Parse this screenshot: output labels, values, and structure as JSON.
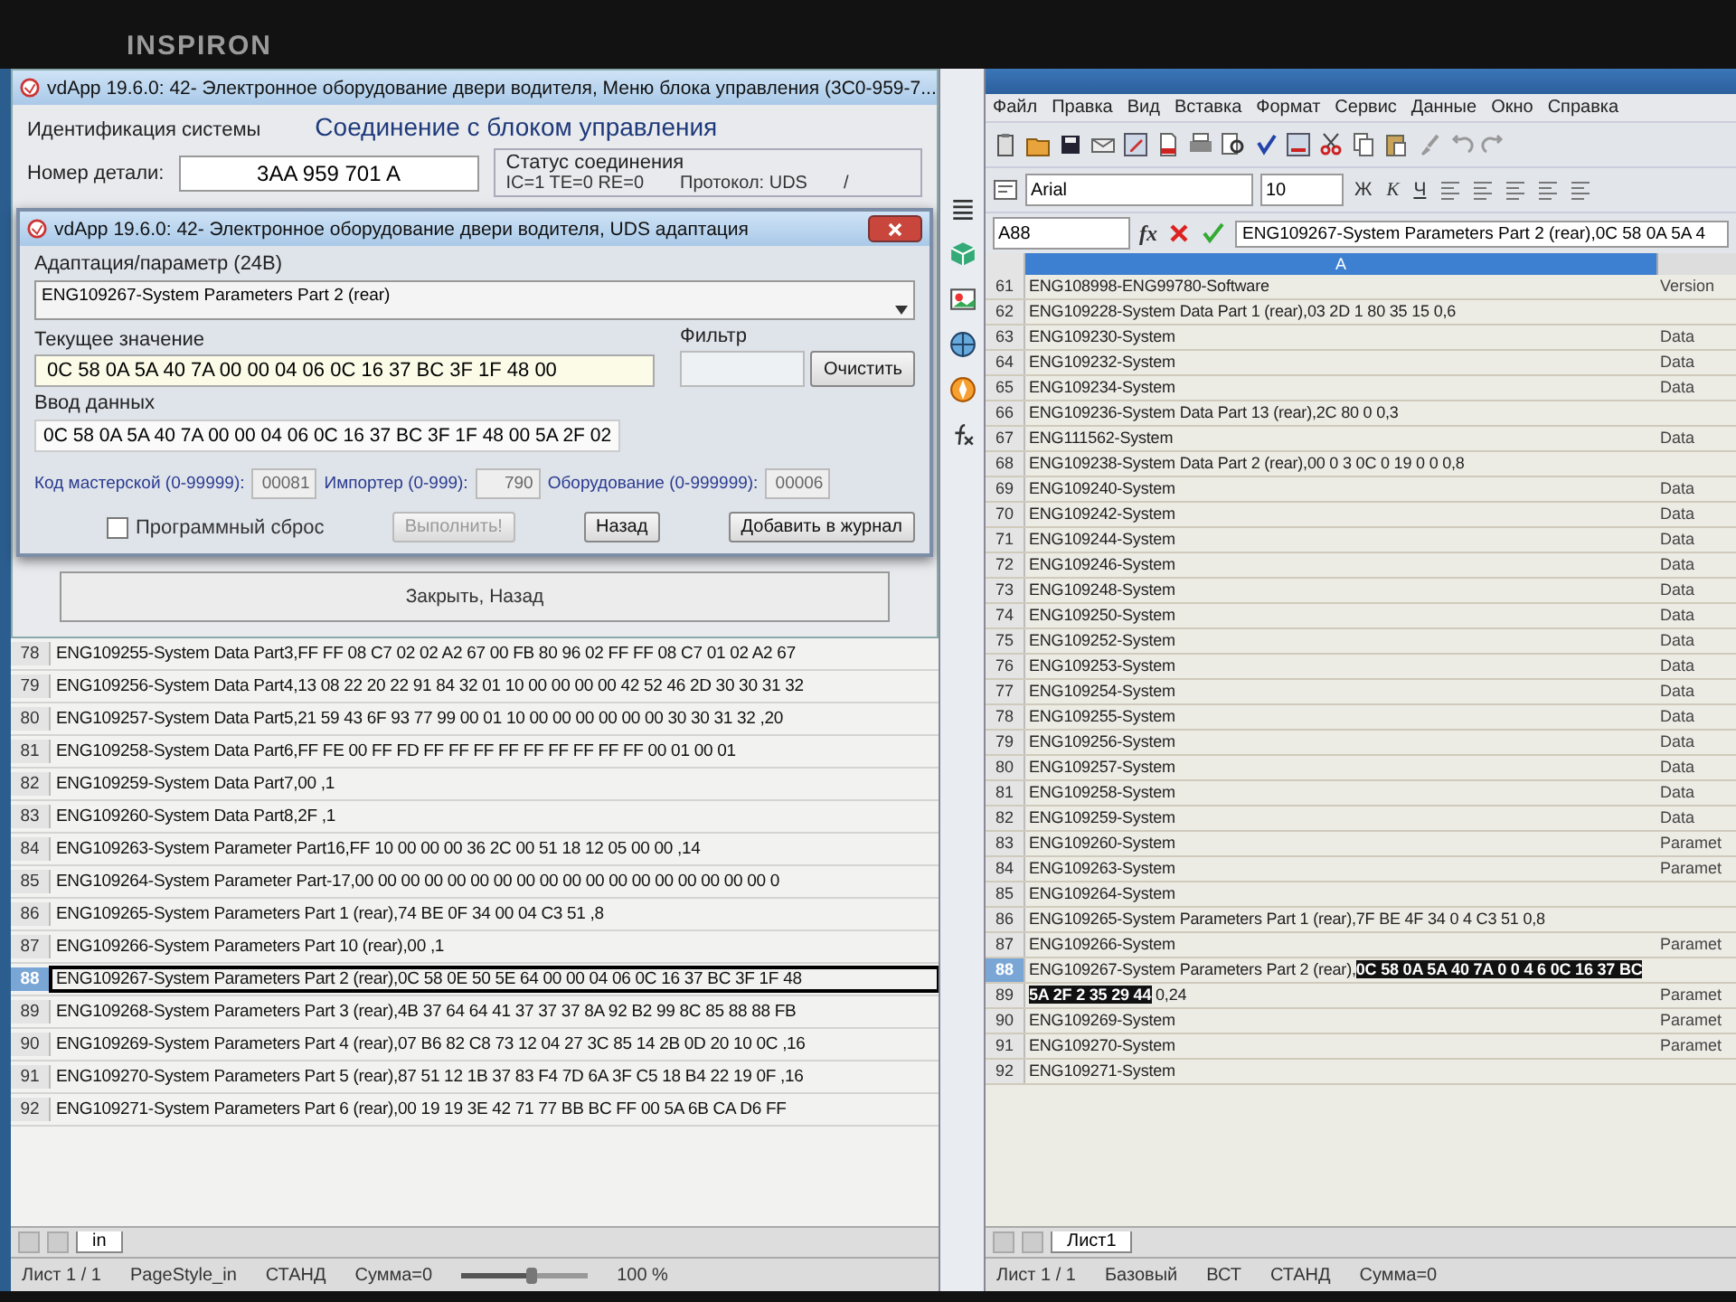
{
  "bezel": {
    "brand": "INSPIRON"
  },
  "main_window": {
    "title": "vdApp 19.6.0: 42- Электронное оборудование двери водителя,  Меню блока управления (3C0-959-7...",
    "group_label": "Идентификация системы",
    "heading": "Соединение с блоком управления",
    "part_label": "Номер детали:",
    "part_value": "3AA 959 701 A",
    "status_group": "Статус соединения",
    "status": "IC=1  TE=0  RE=0",
    "protocol": "Протокол: UDS",
    "spinner": "/"
  },
  "dialog": {
    "title": "vdApp 19.6.0: 42- Электронное оборудование двери водителя,  UDS адаптация",
    "param_label": "Адаптация/параметр (24B)",
    "param_value": "ENG109267-System Parameters Part 2 (rear)",
    "current_label": "Текущее значение",
    "current_value": "0C 58 0A 5A 40 7A 00 00 04 06 0C 16 37 BC 3F 1F 48 00",
    "filter_label": "Фильтр",
    "clear_button": "Очистить",
    "input_label": "Ввод данных",
    "input_value": "0C 58 0A 5A 40 7A 00 00 04 06 0C 16 37 BC 3F 1F 48 00 5A 2F 02",
    "codes": [
      {
        "label": "Код мастерской (0-99999):",
        "value": "00081"
      },
      {
        "label": "Импортер (0-999):",
        "value": "790"
      },
      {
        "label": "Оборудование (0-999999):",
        "value": "00006"
      }
    ],
    "reset": {
      "label": "Программный сброс",
      "checked": false
    },
    "buttons": [
      {
        "label": "Выполнить!",
        "disabled": true
      },
      {
        "label": "Назад",
        "disabled": false
      },
      {
        "label": "Добавить в журнал",
        "disabled": false
      }
    ]
  },
  "close_back_button": "Закрыть, Назад",
  "left_sheet": {
    "rows": [
      {
        "num": "78",
        "text": "ENG109255-System Data Part3,FF FF 08 C7 02 02 A2 67 00 FB 80 96 02 FF FF 08 C7 01 02 A2 67",
        "selected": false
      },
      {
        "num": "79",
        "text": "ENG109256-System Data Part4,13 08 22 20 22 91 84 32 01 10 00 00 00 00 42 52 46 2D 30 30 31 32",
        "selected": false
      },
      {
        "num": "80",
        "text": "ENG109257-System Data Part5,21 59 43 6F 93 77 99 00 01 10 00 00 00 00 00 00 30 30 31 32 ,20",
        "selected": false
      },
      {
        "num": "81",
        "text": "ENG109258-System Data Part6,FF FE 00 FF FD FF FF FF FF FF FF FF FF FF 00 01 00 01",
        "selected": false
      },
      {
        "num": "82",
        "text": "ENG109259-System Data Part7,00 ,1",
        "selected": false
      },
      {
        "num": "83",
        "text": "ENG109260-System Data Part8,2F ,1",
        "selected": false
      },
      {
        "num": "84",
        "text": "ENG109263-System Parameter Part16,FF 10 00 00 00 36 2C 00 51 18 12 05 00 00 ,14",
        "selected": false
      },
      {
        "num": "85",
        "text": "ENG109264-System Parameter Part-17,00 00 00 00 00 00 00 00 00 00 00 00 00 00 00 00 00 00 0",
        "selected": false
      },
      {
        "num": "86",
        "text": "ENG109265-System Parameters Part 1 (rear),74 BE 0F 34 00 04 C3 51 ,8",
        "selected": false
      },
      {
        "num": "87",
        "text": "ENG109266-System Parameters Part 10 (rear),00 ,1",
        "selected": false
      },
      {
        "num": "88",
        "text": "ENG109267-System Parameters Part 2 (rear),0C 58 0E 50 5E 64 00 00 04 06 0C 16 37 BC 3F 1F 48",
        "selected": true
      },
      {
        "num": "89",
        "text": "ENG109268-System Parameters Part 3 (rear),4B 37 64 64 41 37 37 37 8A 92 B2 99 8C 85 88 88 FB",
        "selected": false
      },
      {
        "num": "90",
        "text": "ENG109269-System Parameters Part 4 (rear),07 B6 82 C8 73 12 04 27 3C 85 14 2B 0D 20 10 0C ,16",
        "selected": false
      },
      {
        "num": "91",
        "text": "ENG109270-System Parameters Part 5 (rear),87 51 12 1B 37 83 F4 7D 6A 3F C5 18 B4 22 19 0F ,16",
        "selected": false
      },
      {
        "num": "92",
        "text": "ENG109271-System Parameters Part 6 (rear),00 19 19 3E 42 71 77 BB BC FF 00 5A 6B CA D6 FF",
        "selected": false
      }
    ],
    "tab": "in",
    "mode": "СТАНД",
    "sum": "Сумма=0",
    "page": "Лист 1 / 1",
    "page_style": "PageStyle_in",
    "zoom": "100 %",
    "zoom_slider": {
      "level": 0.55
    }
  },
  "right_sheet": {
    "menu": [
      "Файл",
      "Правка",
      "Вид",
      "Вставка",
      "Формат",
      "Сервис",
      "Данные",
      "Окно",
      "Справка"
    ],
    "font_name": "Arial",
    "font_size": "10",
    "format_buttons": [
      "Ж",
      "К",
      "Ч"
    ],
    "cell_ref": "A88",
    "fx": "fx",
    "formula": "ENG109267-System Parameters Part 2 (rear),0C 58 0A 5A 4",
    "column": "A",
    "rows": [
      {
        "num": "61",
        "a": "ENG108998-ENG99780-Software",
        "b": "Version",
        "selected": false
      },
      {
        "num": "62",
        "a": "ENG109228-System Data Part 1 (rear),03 2D 1 80 35 15 0,6",
        "selected": false
      },
      {
        "num": "63",
        "a": "ENG109230-System",
        "b": "Data",
        "selected": false
      },
      {
        "num": "64",
        "a": "ENG109232-System",
        "b": "Data",
        "selected": false
      },
      {
        "num": "65",
        "a": "ENG109234-System",
        "b": "Data",
        "selected": false
      },
      {
        "num": "66",
        "a": "ENG109236-System Data Part 13 (rear),2C 80 0 0,3",
        "selected": false
      },
      {
        "num": "67",
        "a": "ENG111562-System",
        "b": "Data",
        "selected": false
      },
      {
        "num": "68",
        "a": "ENG109238-System Data Part 2 (rear),00 0 3 0C 0 19 0 0 0,8",
        "selected": false
      },
      {
        "num": "69",
        "a": "ENG109240-System",
        "b": "Data",
        "selected": false
      },
      {
        "num": "70",
        "a": "ENG109242-System",
        "b": "Data",
        "selected": false
      },
      {
        "num": "71",
        "a": "ENG109244-System",
        "b": "Data",
        "selected": false
      },
      {
        "num": "72",
        "a": "ENG109246-System",
        "b": "Data",
        "selected": false
      },
      {
        "num": "73",
        "a": "ENG109248-System",
        "b": "Data",
        "selected": false
      },
      {
        "num": "74",
        "a": "ENG109250-System",
        "b": "Data",
        "selected": false
      },
      {
        "num": "75",
        "a": "ENG109252-System",
        "b": "Data",
        "selected": false
      },
      {
        "num": "76",
        "a": "ENG109253-System",
        "b": "Data",
        "selected": false
      },
      {
        "num": "77",
        "a": "ENG109254-System",
        "b": "Data",
        "selected": false
      },
      {
        "num": "78",
        "a": "ENG109255-System",
        "b": "Data",
        "selected": false
      },
      {
        "num": "79",
        "a": "ENG109256-System",
        "b": "Data",
        "selected": false
      },
      {
        "num": "80",
        "a": "ENG109257-System",
        "b": "Data",
        "selected": false
      },
      {
        "num": "81",
        "a": "ENG109258-System",
        "b": "Data",
        "selected": false
      },
      {
        "num": "82",
        "a": "ENG109259-System",
        "b": "Data",
        "selected": false
      },
      {
        "num": "83",
        "a": "ENG109260-System",
        "b": "Paramet",
        "selected": false
      },
      {
        "num": "84",
        "a": "ENG109263-System",
        "b": "Paramet",
        "selected": false
      },
      {
        "num": "85",
        "a": "ENG109264-System",
        "selected": false
      },
      {
        "num": "86",
        "a": "ENG109265-System Parameters Part 1 (rear),7F BE 4F 34 0 4 C3 51 0,8",
        "selected": false
      },
      {
        "num": "87",
        "a": "ENG109266-System",
        "b": "Paramet",
        "selected": false
      },
      {
        "num": "88",
        "parts": [
          {
            "text": "ENG109267-System Parameters Part 2 (rear),",
            "highlight": false
          },
          {
            "text": "0C 58 0A 5A 40 7A 0 0 4 6 0C 16 37 BC",
            "highlight": true
          }
        ],
        "selected": true
      },
      {
        "num": "89",
        "parts": [
          {
            "text": "5A 2F 2 35 29 44",
            "highlight": true
          },
          {
            "text": " 0,24",
            "highlight": false
          }
        ],
        "b": "Paramet",
        "selected": false
      },
      {
        "num": "90",
        "a": "ENG109269-System",
        "b": "Paramet",
        "selected": false
      },
      {
        "num": "91",
        "a": "ENG109270-System",
        "b": "Paramet",
        "selected": false
      },
      {
        "num": "92",
        "a": "ENG109271-System",
        "selected": false
      }
    ],
    "tab": "Лист1",
    "page": "Лист 1 / 1",
    "style": "Базовый",
    "insert": "ВСТ",
    "mode": "СТАНД",
    "sum": "Сумма=0"
  }
}
